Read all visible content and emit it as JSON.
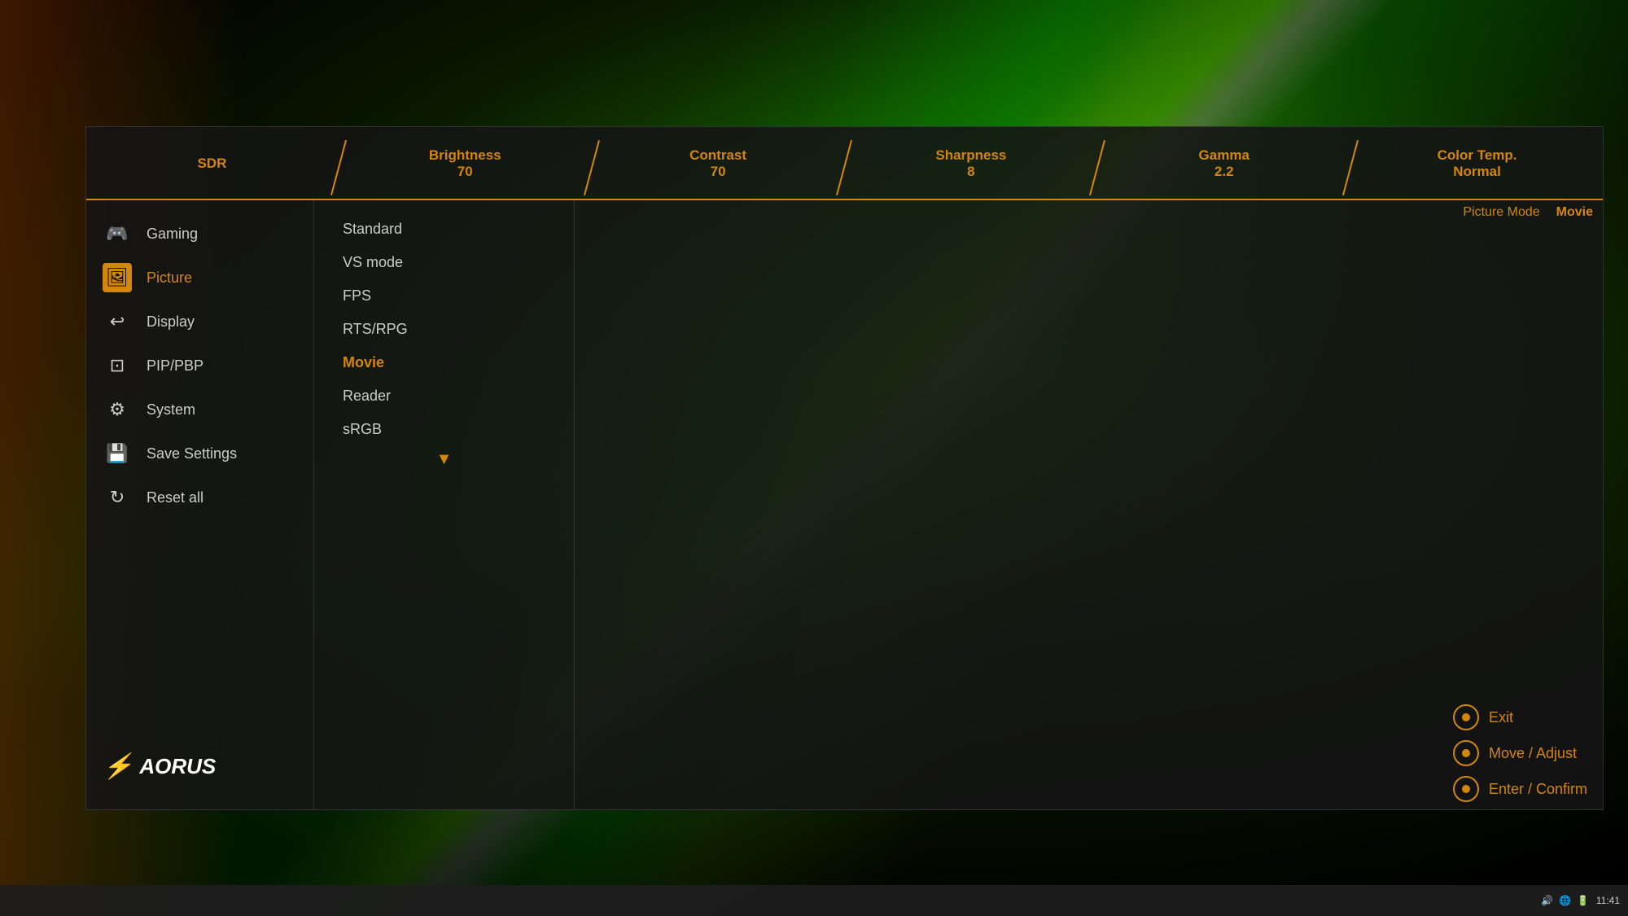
{
  "background": {
    "color": "#000"
  },
  "header": {
    "items": [
      {
        "label": "SDR",
        "value": ""
      },
      {
        "label": "Brightness",
        "value": "70"
      },
      {
        "label": "Contrast",
        "value": "70"
      },
      {
        "label": "Sharpness",
        "value": "8"
      },
      {
        "label": "Gamma",
        "value": "2.2"
      },
      {
        "label": "Color Temp.",
        "value": "Normal"
      }
    ]
  },
  "picture_mode": {
    "label": "Picture Mode",
    "value": "Movie"
  },
  "sidebar": {
    "items": [
      {
        "id": "gaming",
        "icon": "🎮",
        "label": "Gaming",
        "active": false
      },
      {
        "id": "picture",
        "icon": "🖼",
        "label": "Picture",
        "active": true
      },
      {
        "id": "display",
        "icon": "↩",
        "label": "Display",
        "active": false
      },
      {
        "id": "pip",
        "icon": "⊡",
        "label": "PIP/PBP",
        "active": false
      },
      {
        "id": "system",
        "icon": "⚙",
        "label": "System",
        "active": false
      },
      {
        "id": "save",
        "icon": "💾",
        "label": "Save Settings",
        "active": false
      },
      {
        "id": "reset",
        "icon": "↻",
        "label": "Reset all",
        "active": false
      }
    ]
  },
  "menu_items": [
    {
      "label": "Standard",
      "selected": false
    },
    {
      "label": "VS mode",
      "selected": false
    },
    {
      "label": "FPS",
      "selected": false
    },
    {
      "label": "RTS/RPG",
      "selected": false
    },
    {
      "label": "Movie",
      "selected": true
    },
    {
      "label": "Reader",
      "selected": false
    },
    {
      "label": "sRGB",
      "selected": false
    }
  ],
  "controls": [
    {
      "id": "exit",
      "label": "Exit"
    },
    {
      "id": "move",
      "label": "Move / Adjust"
    },
    {
      "id": "enter",
      "label": "Enter / Confirm"
    }
  ],
  "logo": {
    "text": "AORUS",
    "prefix": "⚡"
  },
  "taskbar": {
    "time": "11:41",
    "date": "",
    "icons": [
      "🔊",
      "🌐",
      "🔋"
    ]
  }
}
